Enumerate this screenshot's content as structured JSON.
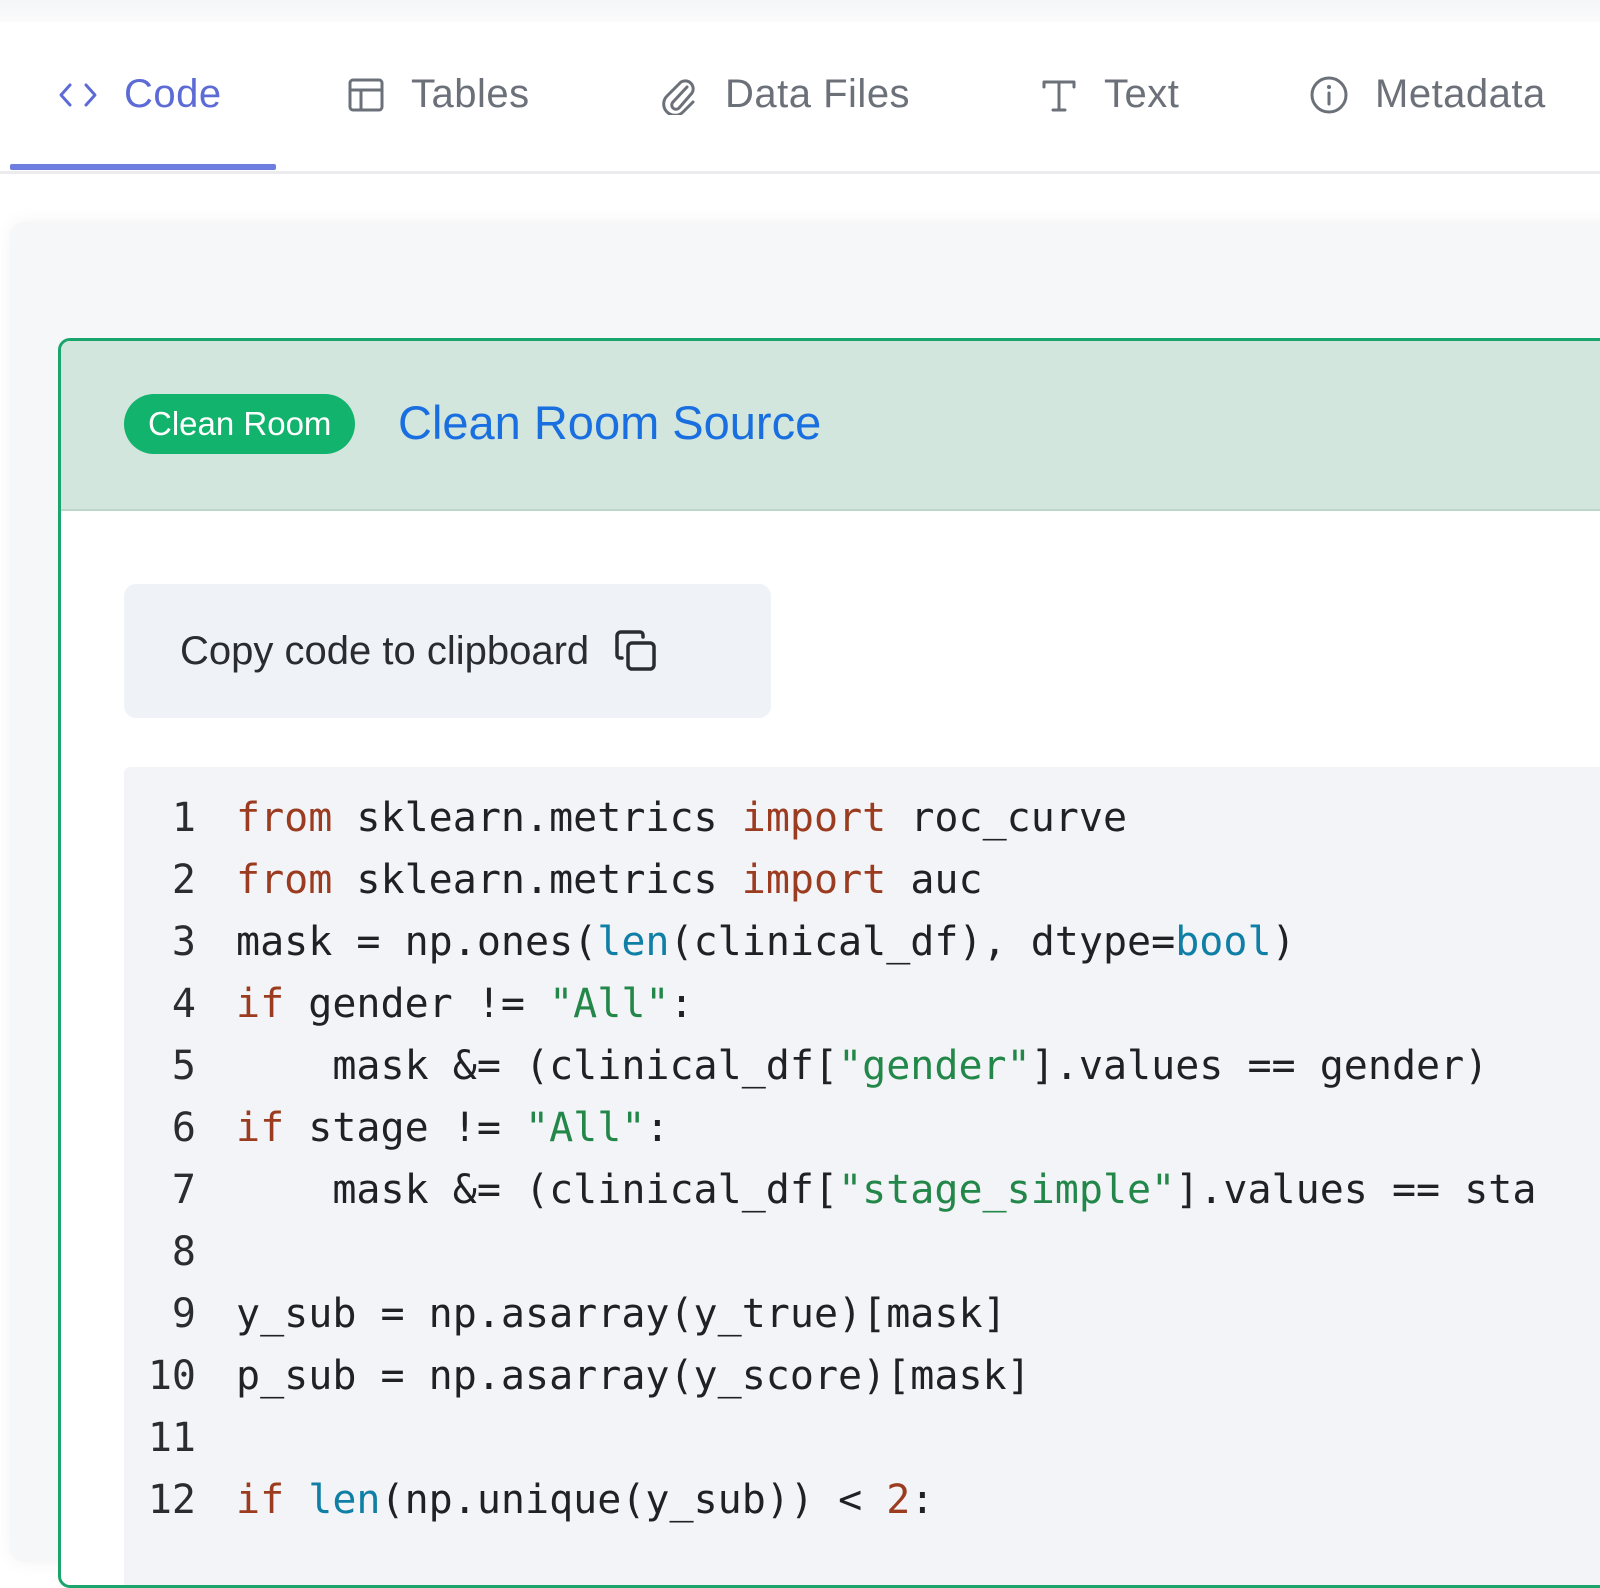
{
  "tabs": [
    {
      "label": "Code",
      "icon": "code-icon",
      "active": true
    },
    {
      "label": "Tables",
      "icon": "table-icon",
      "active": false
    },
    {
      "label": "Data Files",
      "icon": "paperclip-icon",
      "active": false
    },
    {
      "label": "Text",
      "icon": "text-icon",
      "active": false
    },
    {
      "label": "Metadata",
      "icon": "info-icon",
      "active": false
    }
  ],
  "card": {
    "badge": "Clean Room",
    "title": "Clean Room Source",
    "copy_label": "Copy code to clipboard",
    "copy_icon": "copy-icon"
  },
  "code": {
    "line_numbers": [
      "1",
      "2",
      "3",
      "4",
      "5",
      "6",
      "7",
      "8",
      "9",
      "10",
      "11",
      "12"
    ],
    "lines": [
      [
        {
          "t": "from",
          "c": "kw"
        },
        {
          "t": " sklearn.metrics ",
          "c": ""
        },
        {
          "t": "import",
          "c": "kw"
        },
        {
          "t": " roc_curve",
          "c": ""
        }
      ],
      [
        {
          "t": "from",
          "c": "kw"
        },
        {
          "t": " sklearn.metrics ",
          "c": ""
        },
        {
          "t": "import",
          "c": "kw"
        },
        {
          "t": " auc",
          "c": ""
        }
      ],
      [
        {
          "t": "mask = np.ones(",
          "c": ""
        },
        {
          "t": "len",
          "c": "bi"
        },
        {
          "t": "(clinical_df), dtype=",
          "c": ""
        },
        {
          "t": "bool",
          "c": "bi"
        },
        {
          "t": ")",
          "c": ""
        }
      ],
      [
        {
          "t": "if",
          "c": "kw"
        },
        {
          "t": " gender != ",
          "c": ""
        },
        {
          "t": "\"All\"",
          "c": "st"
        },
        {
          "t": ":",
          "c": ""
        }
      ],
      [
        {
          "t": "    mask &= (clinical_df[",
          "c": ""
        },
        {
          "t": "\"gender\"",
          "c": "st"
        },
        {
          "t": "].values == gender)",
          "c": ""
        }
      ],
      [
        {
          "t": "if",
          "c": "kw"
        },
        {
          "t": " stage != ",
          "c": ""
        },
        {
          "t": "\"All\"",
          "c": "st"
        },
        {
          "t": ":",
          "c": ""
        }
      ],
      [
        {
          "t": "    mask &= (clinical_df[",
          "c": ""
        },
        {
          "t": "\"stage_simple\"",
          "c": "st"
        },
        {
          "t": "].values == sta",
          "c": ""
        }
      ],
      [],
      [
        {
          "t": "y_sub = np.asarray(y_true)[mask]",
          "c": ""
        }
      ],
      [
        {
          "t": "p_sub = np.asarray(y_score)[mask]",
          "c": ""
        }
      ],
      [],
      [
        {
          "t": "if",
          "c": "kw"
        },
        {
          "t": " ",
          "c": ""
        },
        {
          "t": "len",
          "c": "bi"
        },
        {
          "t": "(np.unique(y_sub)) < ",
          "c": ""
        },
        {
          "t": "2",
          "c": "num"
        },
        {
          "t": ":",
          "c": ""
        }
      ]
    ]
  },
  "colors": {
    "accent": "#5c6bd6",
    "badge_bg": "#12b36c",
    "header_bg": "#d2e6dd",
    "card_border": "#19a56b",
    "title": "#1a6fe0",
    "keyword": "#9b3b20",
    "builtin": "#0f7fa6",
    "string": "#23874a"
  }
}
